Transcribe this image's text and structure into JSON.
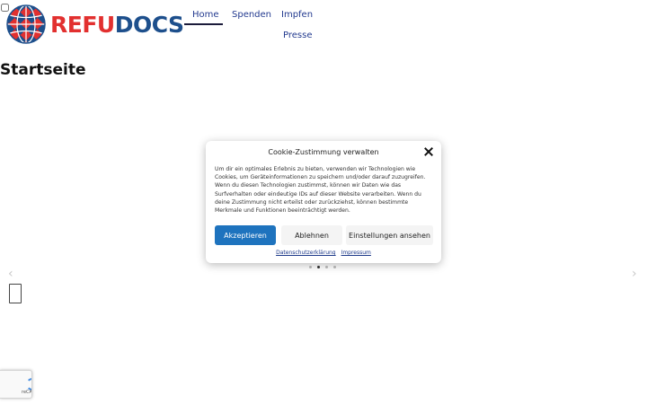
{
  "header": {
    "logo": {
      "part1": "REFU",
      "part2": "DOCS"
    },
    "nav": [
      {
        "label": "Home",
        "active": true
      },
      {
        "label": "Spenden"
      },
      {
        "label": "Impfen"
      },
      {
        "label": "Presse"
      }
    ]
  },
  "page": {
    "title": "Startseite"
  },
  "slider": {
    "prev_icon": "chevron-left-icon",
    "next_icon": "chevron-right-icon",
    "dots": 4,
    "active_dot": 2
  },
  "cookie_dialog": {
    "title": "Cookie-Zustimmung verwalten",
    "body": "Um dir ein optimales Erlebnis zu bieten, verwenden wir Technologien wie Cookies, um Geräteinformationen zu speichern und/oder darauf zuzugreifen. Wenn du diesen Technologien zustimmst, können wir Daten wie das Surfverhalten oder eindeutige IDs auf dieser Website verarbeiten. Wenn du deine Zustimmung nicht erteilst oder zurückziehst, können bestimmte Merkmale und Funktionen beeinträchtigt werden.",
    "accept_label": "Akzeptieren",
    "deny_label": "Ablehnen",
    "settings_label": "Einstellungen ansehen",
    "privacy_link": "Datenschutzerklärung",
    "imprint_link": "Impressum"
  },
  "recaptcha": {
    "label": "reCA"
  },
  "colors": {
    "brand_red": "#e2302f",
    "brand_blue": "#1d4f8c",
    "nav_blue": "#233a8f",
    "accept_blue": "#1e73be"
  }
}
